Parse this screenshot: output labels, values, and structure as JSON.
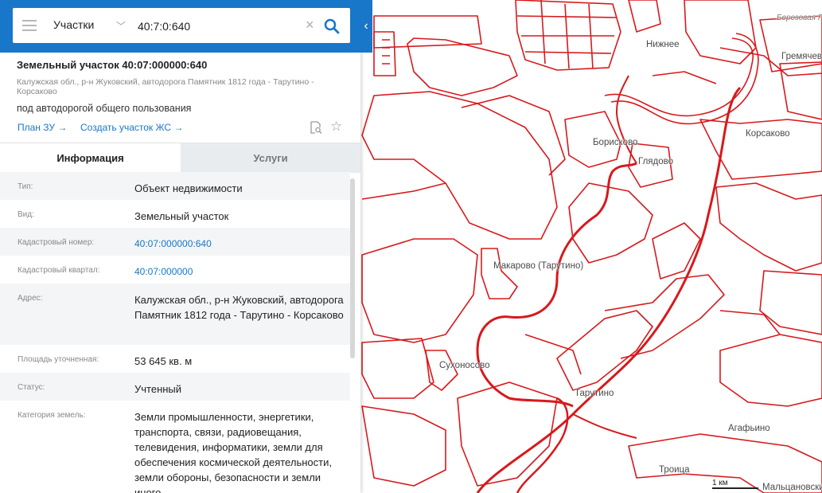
{
  "search": {
    "layer": "Участки",
    "value": "40:7:0:640"
  },
  "parcel": {
    "title": "Земельный участок 40:07:000000:640",
    "address": "Калужская обл., р-н Жуковский, автодорога Памятник 1812 года - Тарутино - Корсаково",
    "description": "под автодорогой общего пользования",
    "links": [
      "План ЗУ →",
      "Создать участок ЖС →"
    ]
  },
  "tabs": [
    "Информация",
    "Услуги"
  ],
  "fields": [
    {
      "label": "Тип:",
      "value": "Объект недвижимости"
    },
    {
      "label": "Вид:",
      "value": "Земельный участок"
    },
    {
      "label": "Кадастровый номер:",
      "value": "40:07:000000:640"
    },
    {
      "label": "Кадастровый квартал:",
      "value": "40:07:000000"
    },
    {
      "label": "Адрес:",
      "value": "Калужская обл., р-н Жуковский, автодорога Памятник 1812 года - Тарутино - Корсаково"
    },
    {
      "label": "Площадь уточненная:",
      "value": "53 645 кв. м"
    },
    {
      "label": "Статус:",
      "value": "Учтенный"
    },
    {
      "label": "Категория земель:",
      "value": "Земли промышленности, энергетики, транспорта, связи, радиовещания, телевидения, информатики, земли для обеспечения космической деятельности, земли обороны, безопасности и земли иного"
    }
  ],
  "map": {
    "labels": [
      "Нижнее",
      "Березовая Роща",
      "Гремячево",
      "Борисково",
      "Глядово",
      "Корсаково",
      "Макарово (Тарутино)",
      "Сухоносово",
      "Тарутино",
      "Агафьино",
      "Троица",
      "Мальцановские"
    ],
    "scale": "1 км",
    "parcel_color": "#d7191c"
  },
  "icons": [
    "menu-icon",
    "chevron-down-icon",
    "close-icon",
    "search-icon",
    "chevron-left-icon",
    "document-search-icon",
    "star-icon"
  ]
}
